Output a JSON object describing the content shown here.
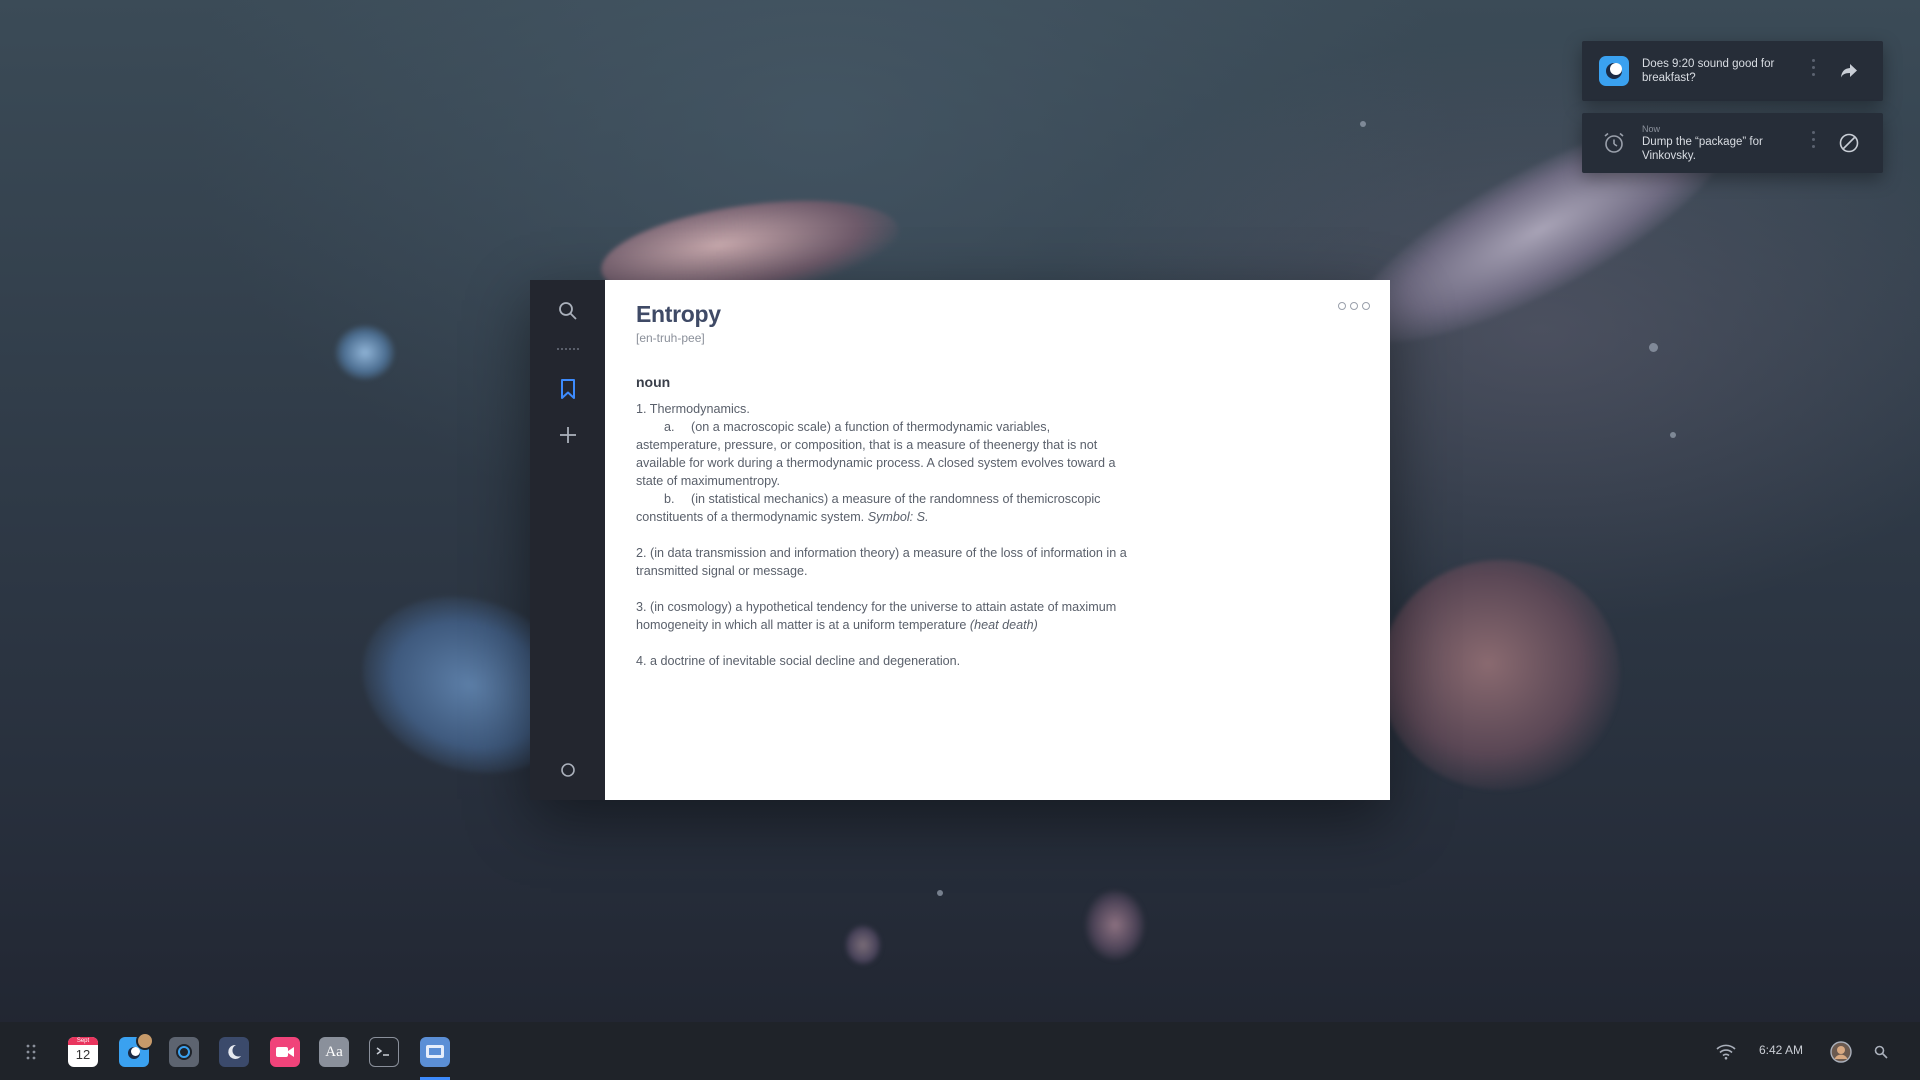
{
  "dictionary": {
    "word": "Entropy",
    "pronunciation": "[en-truh-pee]",
    "part_of_speech": "noun",
    "definitions": {
      "d1": "1. Thermodynamics.",
      "d1a_label": "a.",
      "d1a": "(on a macroscopic scale) a function of thermodynamic variables, astemperature, pressure, or composition, that is a measure of theenergy that is not available for work during a thermodynamic process. A closed system evolves toward a state of maximumentropy.",
      "d1b_label": "b.",
      "d1b": "(in statistical mechanics) a measure of the randomness of themicroscopic constituents of a thermodynamic system.",
      "d1b_italic": "Symbol: S.",
      "d2": "2. (in data transmission and information theory) a measure of the loss of information in a transmitted signal or message.",
      "d3": "3. (in cosmology) a hypothetical tendency for the universe to attain astate of maximum homogeneity in which all matter is at a uniform temperature",
      "d3_italic": "(heat death)",
      "d4": "4. a doctrine of inevitable social decline and degeneration."
    },
    "sidebar_icons": [
      "search-icon",
      "bookmark-icon",
      "plus-icon",
      "circle-icon"
    ]
  },
  "notifications": [
    {
      "app_icon": "chat-app-icon",
      "text": "Does 9:20 sound good for breakfast?",
      "action_icon": "reply-icon"
    },
    {
      "app_icon": "alarm-clock-icon",
      "time": "Now",
      "text": "Dump the “package” for Vinkovsky.",
      "action_icon": "dismiss-icon"
    }
  ],
  "taskbar": {
    "calendar": {
      "month": "Sept",
      "day": "12"
    },
    "dictionary_label": "Aa",
    "clock": "6:42 AM",
    "accent_color": "#3d8bfd"
  }
}
